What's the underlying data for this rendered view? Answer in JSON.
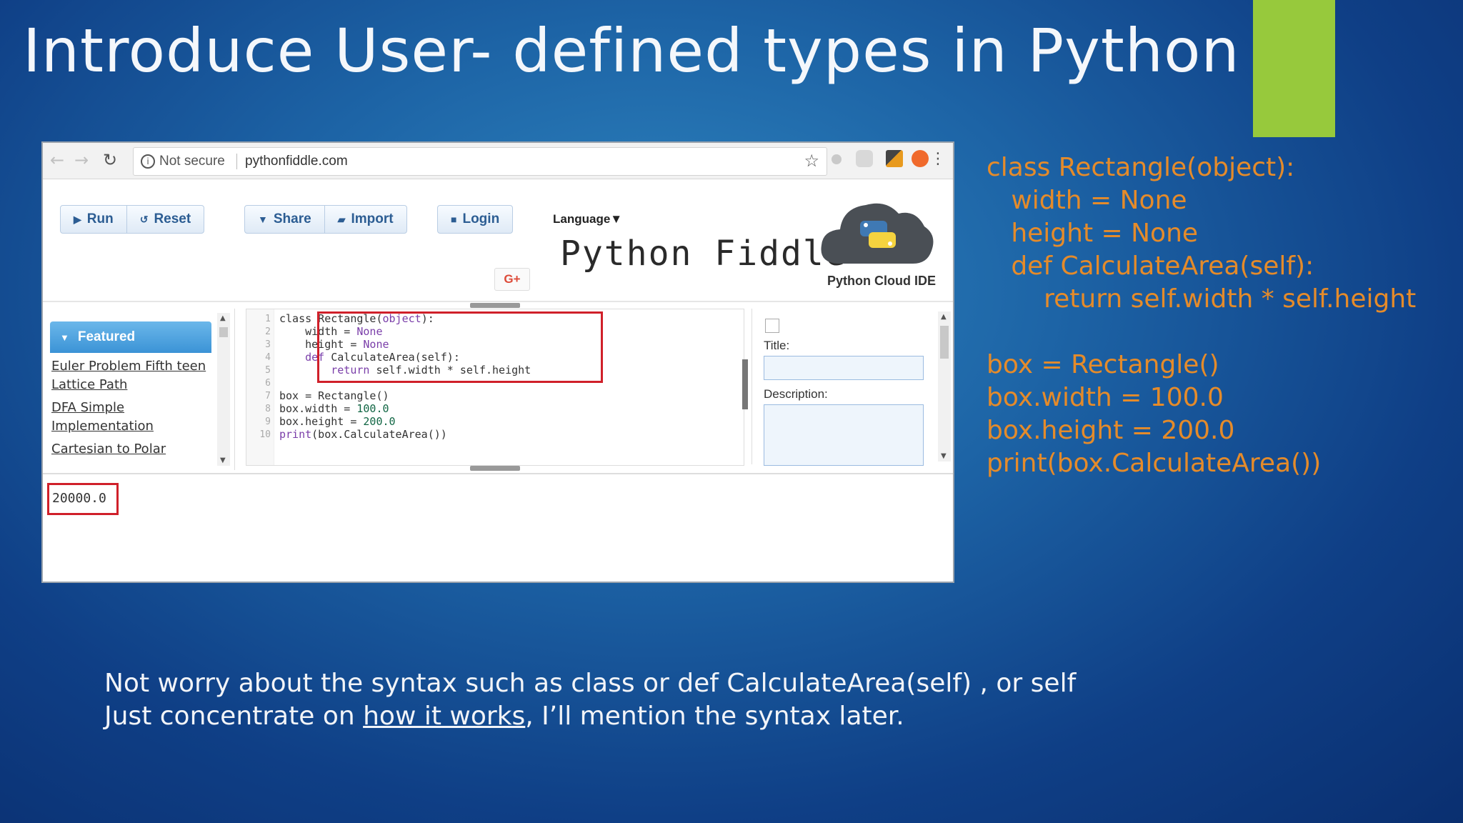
{
  "slide": {
    "title": "Introduce User- defined types in Python",
    "accent_color": "#97c93c",
    "code_color": "#e58b2a"
  },
  "browser": {
    "not_secure": "Not secure",
    "url": "pythonfiddle.com"
  },
  "fiddle": {
    "buttons": {
      "run": "Run",
      "reset": "Reset",
      "share": "Share",
      "import": "Import",
      "login": "Login"
    },
    "language_label": "Language▼",
    "brand": "Python Fiddle",
    "cloud_caption": "Python Cloud IDE",
    "gplus": "G+",
    "featured": "Featured",
    "featured_links": [
      "Euler Problem Fifth teen Lattice Path",
      "DFA Simple Implementation",
      "Cartesian to Polar"
    ],
    "title_label": "Title:",
    "description_label": "Description:",
    "output": "20000.0"
  },
  "editor": {
    "line_numbers": [
      "1",
      "2",
      "3",
      "4",
      "5",
      "6",
      "7",
      "8",
      "9",
      "10"
    ],
    "lines": {
      "l1a": "class Rectangle(",
      "l1b": "object",
      "l1c": "):",
      "l2a": "    width = ",
      "l2b": "None",
      "l3a": "    height = ",
      "l3b": "None",
      "l4a": "    ",
      "l4b": "def",
      "l4c": " CalculateArea(self):",
      "l5a": "        ",
      "l5b": "return",
      "l5c": " self.width * self.height",
      "l7": "box = Rectangle()",
      "l8a": "box.width = ",
      "l8b": "100.0",
      "l9a": "box.height = ",
      "l9b": "200.0",
      "l10a": "print",
      "l10b": "(box.CalculateArea())"
    }
  },
  "code_right": [
    "class Rectangle(object):",
    "   width = None",
    "   height = None",
    "   def CalculateArea(self):",
    "       return self.width * self.height",
    "",
    "box = Rectangle()",
    "box.width = 100.0",
    "box.height = 200.0",
    "print(box.CalculateArea())"
  ],
  "bottom": {
    "line1": "Not worry about the syntax such as class or def CalculateArea(self) , or self",
    "line2_prefix": "Just concentrate on ",
    "line2_link": "how it works",
    "line2_suffix": ", I’ll mention the syntax later."
  }
}
